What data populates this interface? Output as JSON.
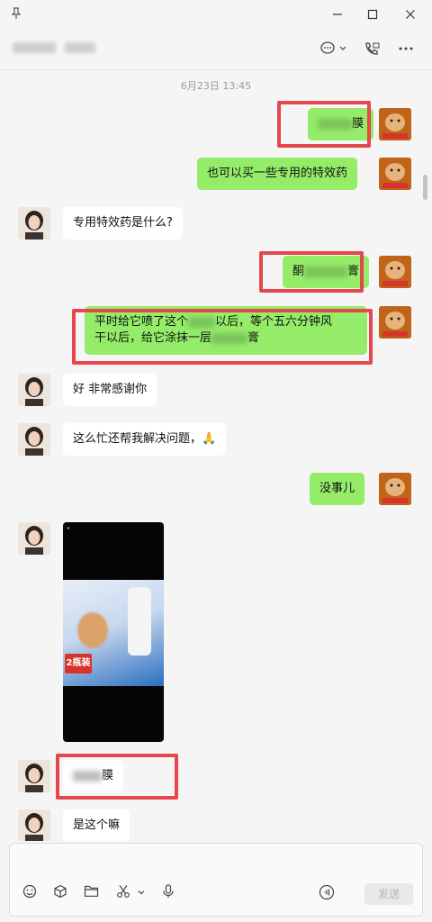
{
  "window": {
    "pin_icon": "pin-icon",
    "close_glyph": "✕",
    "maximize_glyph": "☐",
    "minimize_glyph": "—"
  },
  "header": {
    "contact_name": "",
    "chat_icon": "chat-bubble-icon",
    "call_icon": "phone-icon",
    "more_icon": "more-icon"
  },
  "chat": {
    "timestamp": "6月23日 13:45",
    "messages": [
      {
        "from": "me",
        "text": "",
        "blurred": true,
        "suffix": "膜"
      },
      {
        "from": "me",
        "text": "也可以买一些专用的特效药"
      },
      {
        "from": "them",
        "text": "专用特效药是什么?"
      },
      {
        "from": "me",
        "prefix": "酮",
        "text": "",
        "blurred": true,
        "suffix": "膏"
      },
      {
        "from": "me",
        "line1_prefix": "平时给它喷了这个",
        "line1_suffix": "以后，等个五六分钟风",
        "line2_prefix": "干以后，给它涂抹一层",
        "line2_suffix": "膏"
      },
      {
        "from": "them",
        "text": "好 非常感谢你"
      },
      {
        "from": "them",
        "text": "这么忙还帮我解决问题，🙏"
      },
      {
        "from": "me",
        "text": "没事儿"
      },
      {
        "from": "them",
        "type": "image",
        "badge": "2瓶装"
      },
      {
        "from": "them",
        "text": "",
        "blurred": true,
        "suffix": "膜"
      },
      {
        "from": "them",
        "text": "是这个嘛"
      }
    ]
  },
  "composer": {
    "send_label": "发送",
    "tools": [
      "emoji-icon",
      "cube-icon",
      "folder-icon",
      "scissors-icon",
      "chevron-down-icon",
      "microphone-icon"
    ],
    "voice_icon": "voice-icon"
  },
  "colors": {
    "my_bubble": "#95ec69",
    "their_bubble": "#ffffff",
    "highlight": "#e5474d",
    "background": "#f5f5f5"
  }
}
